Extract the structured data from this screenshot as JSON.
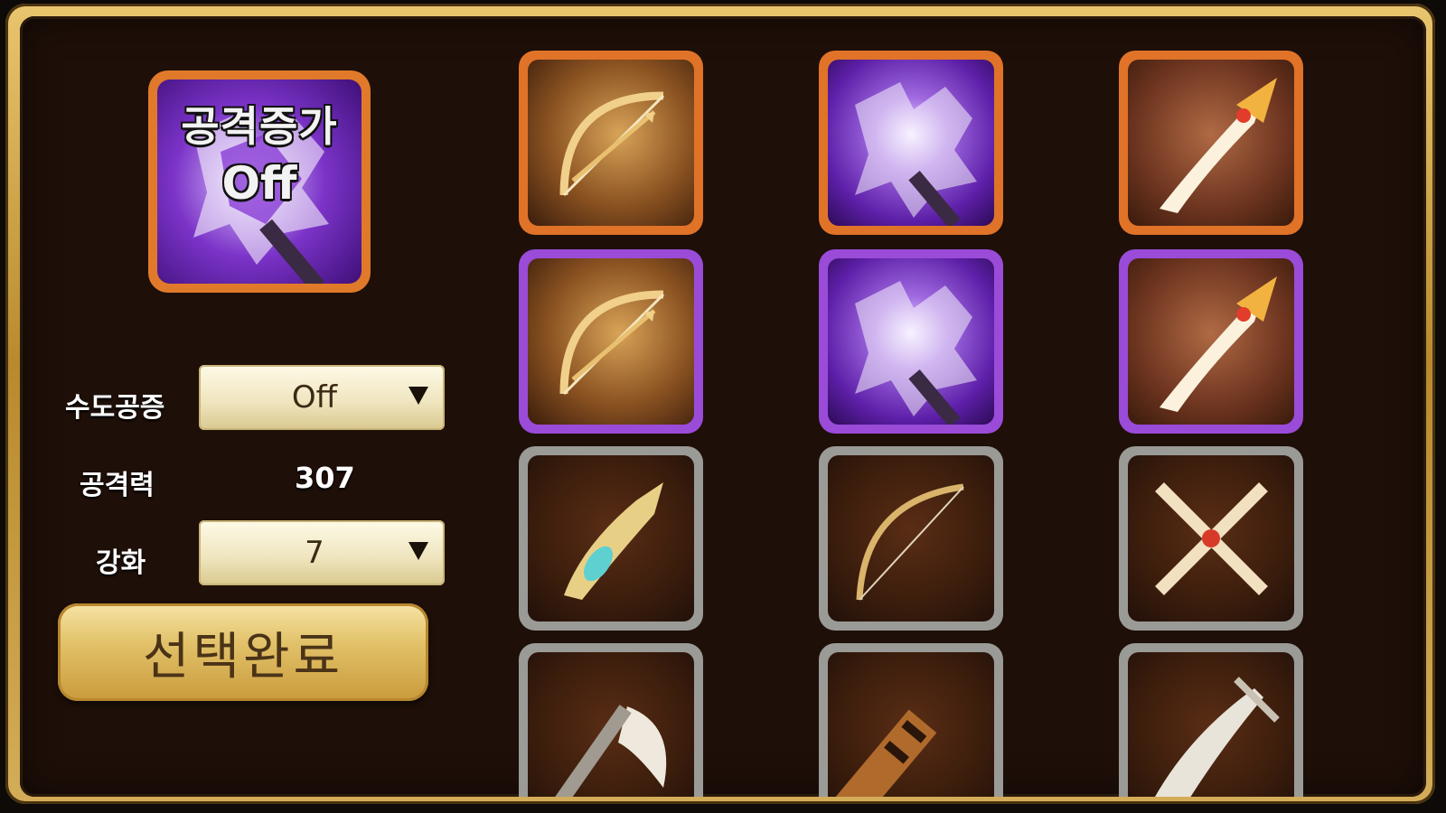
{
  "preview": {
    "title": "공격증가",
    "status": "Off"
  },
  "controls": {
    "sudo_label": "수도공증",
    "sudo_value": "Off",
    "attack_label": "공격력",
    "attack_value": "307",
    "enhance_label": "강화",
    "enhance_value": "7"
  },
  "confirm_label": "선택완료",
  "weapons": [
    {
      "icon": "bow-icon",
      "frame": "orange"
    },
    {
      "icon": "axe-icon",
      "frame": "orange"
    },
    {
      "icon": "spear-icon",
      "frame": "orange"
    },
    {
      "icon": "bow-icon",
      "frame": "purple"
    },
    {
      "icon": "axe-icon",
      "frame": "purple"
    },
    {
      "icon": "spear-icon",
      "frame": "purple"
    },
    {
      "icon": "staff-icon",
      "frame": "silver"
    },
    {
      "icon": "bow-icon",
      "frame": "silver"
    },
    {
      "icon": "crossed-swords-icon",
      "frame": "silver"
    },
    {
      "icon": "axe-icon",
      "frame": "silver"
    },
    {
      "icon": "cannon-icon",
      "frame": "silver"
    },
    {
      "icon": "sword-icon",
      "frame": "silver"
    }
  ],
  "colors": {
    "frame_gold": "#d4ad58",
    "panel_bg": "#1e0f08",
    "legendary_frame": "#e07328",
    "epic_frame": "#9a4bd8",
    "rare_frame": "#9a9a96"
  }
}
